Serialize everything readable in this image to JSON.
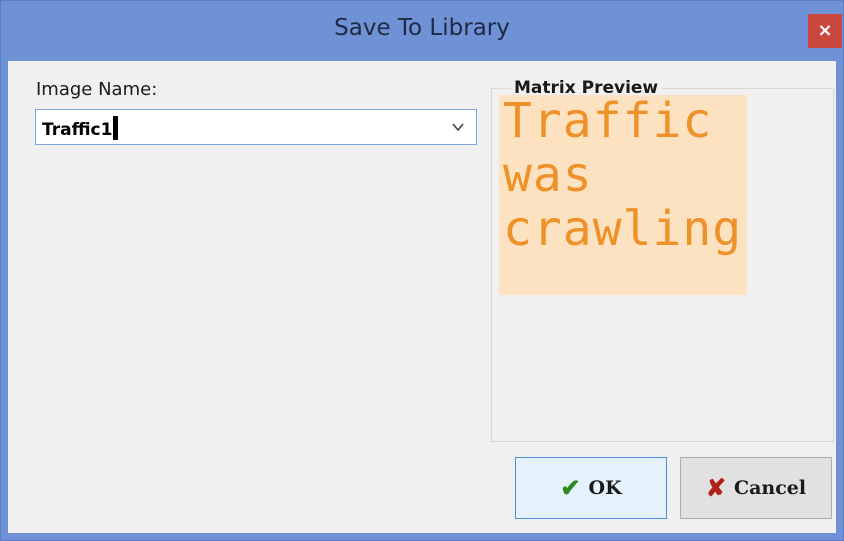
{
  "window": {
    "title": "Save To Library",
    "close_glyph": "×"
  },
  "form": {
    "image_name_label": "Image Name:",
    "image_name_value": "Traffic1"
  },
  "preview": {
    "group_label": "Matrix Preview",
    "lines": [
      "Traffic",
      "was",
      "crawling"
    ],
    "text_color": "#ee9128",
    "background_color": "#fde2c2"
  },
  "buttons": {
    "ok_label": "OK",
    "ok_icon": "checkmark-icon",
    "ok_glyph": "✔",
    "cancel_label": "Cancel",
    "cancel_icon": "x-icon",
    "cancel_glyph": "✘"
  },
  "colors": {
    "titlebar": "#6f92d6",
    "close_button": "#c9463d",
    "client_background": "#f0f0f0"
  }
}
